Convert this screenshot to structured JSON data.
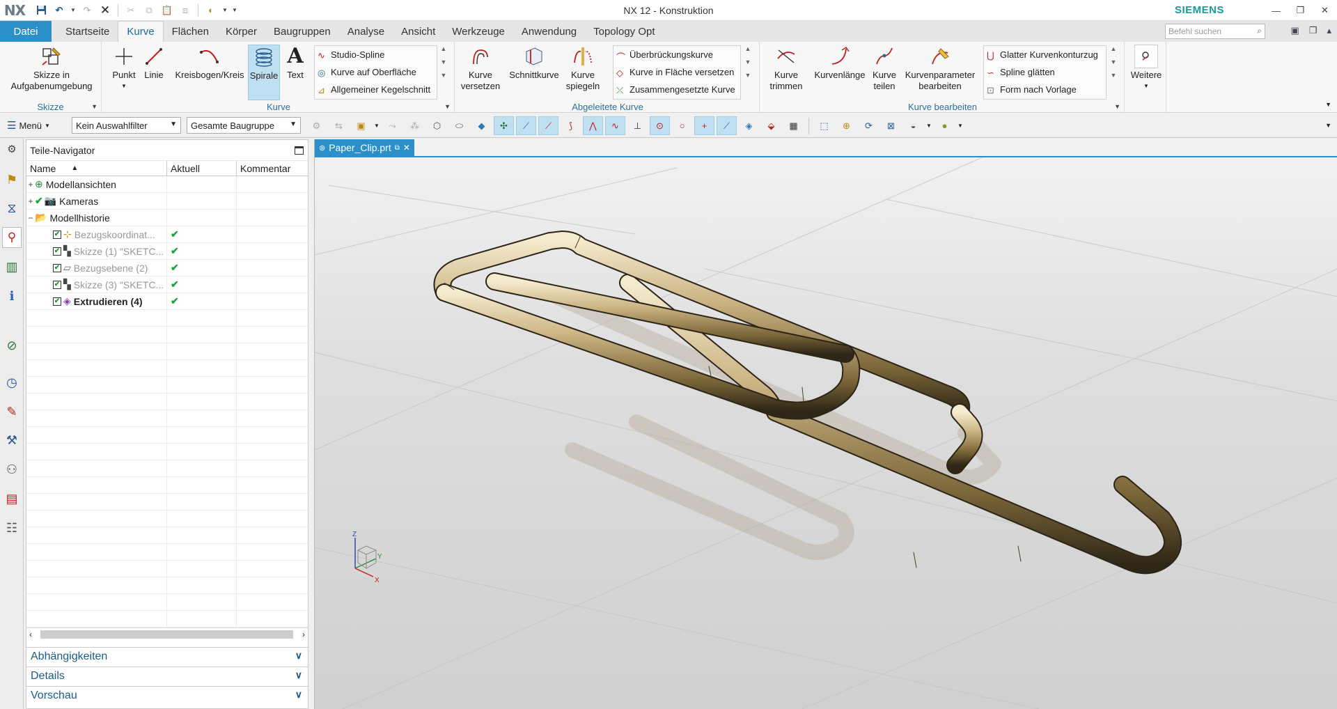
{
  "window": {
    "logo": "NX",
    "title": "NX 12 - Konstruktion",
    "brand": "SIEMENS"
  },
  "tabs": {
    "file": "Datei",
    "items": [
      "Startseite",
      "Kurve",
      "Flächen",
      "Körper",
      "Baugruppen",
      "Analyse",
      "Ansicht",
      "Werkzeuge",
      "Anwendung",
      "Topology Opt"
    ],
    "active": "Kurve",
    "search_placeholder": "Befehl suchen"
  },
  "ribbon": {
    "skizze": {
      "button": "Skizze in Aufgabenumgebung",
      "label": "Skizze"
    },
    "kurve": {
      "buttons": [
        "Punkt",
        "Linie",
        "Kreisbogen/Kreis",
        "Spirale",
        "Text"
      ],
      "gallery": [
        "Studio-Spline",
        "Kurve auf Oberfläche",
        "Allgemeiner Kegelschnitt"
      ],
      "label": "Kurve"
    },
    "abgeleitete": {
      "buttons": [
        "Kurve versetzen",
        "Schnittkurve",
        "Kurve spiegeln"
      ],
      "gallery": [
        "Überbrückungskurve",
        "Kurve in Fläche versetzen",
        "Zusammengesetzte Kurve"
      ],
      "label": "Abgeleitete Kurve"
    },
    "bearbeiten": {
      "buttons": [
        "Kurve trimmen",
        "Kurvenlänge",
        "Kurve teilen",
        "Kurvenparameter bearbeiten"
      ],
      "gallery": [
        "Glatter Kurvenkonturzug",
        "Spline glätten",
        "Form nach Vorlage"
      ],
      "label": "Kurve bearbeiten"
    },
    "weitere": "Weitere"
  },
  "toolbar": {
    "menu": "Menü",
    "filter": "Kein Auswahlfilter",
    "scope": "Gesamte Baugruppe"
  },
  "navigator": {
    "title": "Teile-Navigator",
    "columns": [
      "Name",
      "Aktuell",
      "Kommentar"
    ],
    "rows": [
      {
        "name": "Modellansichten"
      },
      {
        "name": "Kameras"
      },
      {
        "name": "Modellhistorie"
      },
      {
        "name": "Bezugskoordinat..."
      },
      {
        "name": "Skizze (1) \"SKETC..."
      },
      {
        "name": "Bezugsebene (2)"
      },
      {
        "name": "Skizze (3) \"SKETC..."
      },
      {
        "name": "Extrudieren (4)"
      }
    ],
    "sections": [
      "Abhängigkeiten",
      "Details",
      "Vorschau"
    ]
  },
  "document": {
    "tab": "Paper_Clip.prt"
  },
  "triad": {
    "x": "X",
    "y": "Y",
    "z": "Z"
  }
}
